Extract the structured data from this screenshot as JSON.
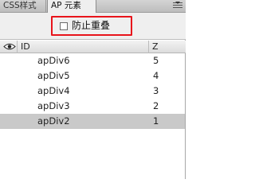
{
  "tabs": [
    {
      "label": "CSS样式"
    },
    {
      "label": "AP 元素"
    }
  ],
  "toolbar": {
    "prevent_overlap_label": "防止重叠",
    "prevent_overlap_checked": false
  },
  "table": {
    "columns": {
      "visibility": "eye-icon",
      "id": "ID",
      "z": "Z"
    },
    "rows": [
      {
        "id": "apDiv6",
        "z": "5",
        "selected": false
      },
      {
        "id": "apDiv5",
        "z": "4",
        "selected": false
      },
      {
        "id": "apDiv4",
        "z": "3",
        "selected": false
      },
      {
        "id": "apDiv3",
        "z": "2",
        "selected": false
      },
      {
        "id": "apDiv2",
        "z": "1",
        "selected": true
      }
    ]
  },
  "colors": {
    "highlight_border": "#e8141b",
    "selected_row": "#c9c9c9"
  }
}
